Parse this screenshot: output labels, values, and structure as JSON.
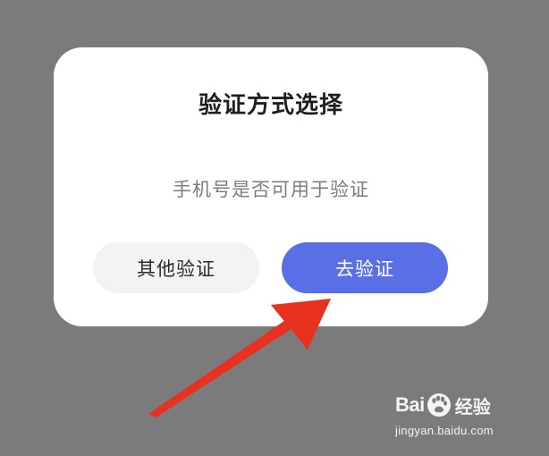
{
  "dialog": {
    "title": "验证方式选择",
    "message": "手机号是否可用于验证",
    "buttons": {
      "other_label": "其他验证",
      "go_label": "去验证"
    }
  },
  "watermark": {
    "brand_left": "Bai",
    "brand_right": "经验",
    "url": "jingyan.baidu.com"
  },
  "colors": {
    "overlay": "#7b7b7b",
    "primary_button": "#5a6ee6",
    "secondary_button": "#f3f3f3",
    "arrow": "#e8311f"
  },
  "icons": {
    "arrow": "red-pointer-arrow-icon",
    "watermark_logo": "baidu-paw-icon"
  }
}
